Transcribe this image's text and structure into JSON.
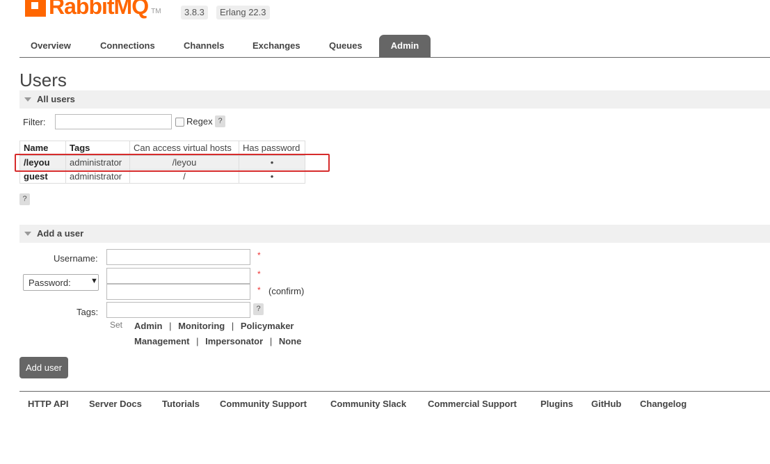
{
  "app": {
    "logo_text": "RabbitMQ",
    "tm": "TM",
    "version": "3.8.3",
    "erlang": "Erlang 22.3"
  },
  "tabs": [
    "Overview",
    "Connections",
    "Channels",
    "Exchanges",
    "Queues",
    "Admin"
  ],
  "page_title": "Users",
  "all_users": {
    "header": "All users",
    "filter_label": "Filter:",
    "filter_value": "",
    "regex_label": "Regex",
    "help": "?",
    "columns": [
      "Name",
      "Tags",
      "Can access virtual hosts",
      "Has password"
    ],
    "rows": [
      {
        "name": "/leyou",
        "tags": "administrator",
        "vhosts": "/leyou",
        "has_password": "•"
      },
      {
        "name": "guest",
        "tags": "administrator",
        "vhosts": "/",
        "has_password": "•"
      }
    ]
  },
  "add_user": {
    "header": "Add a user",
    "username_label": "Username:",
    "password_select": "Password:",
    "confirm_label": "(confirm)",
    "tags_label": "Tags:",
    "required": "*",
    "set_label": "Set",
    "tag_links": [
      "Admin",
      "Monitoring",
      "Policymaker",
      "Management",
      "Impersonator",
      "None"
    ],
    "separator": "|",
    "button": "Add user"
  },
  "footer": [
    "HTTP API",
    "Server Docs",
    "Tutorials",
    "Community Support",
    "Community Slack",
    "Commercial Support",
    "Plugins",
    "GitHub",
    "Changelog"
  ],
  "colors": {
    "brand": "#ff6600",
    "highlight": "#d62b2b",
    "tab_active": "#666666"
  }
}
